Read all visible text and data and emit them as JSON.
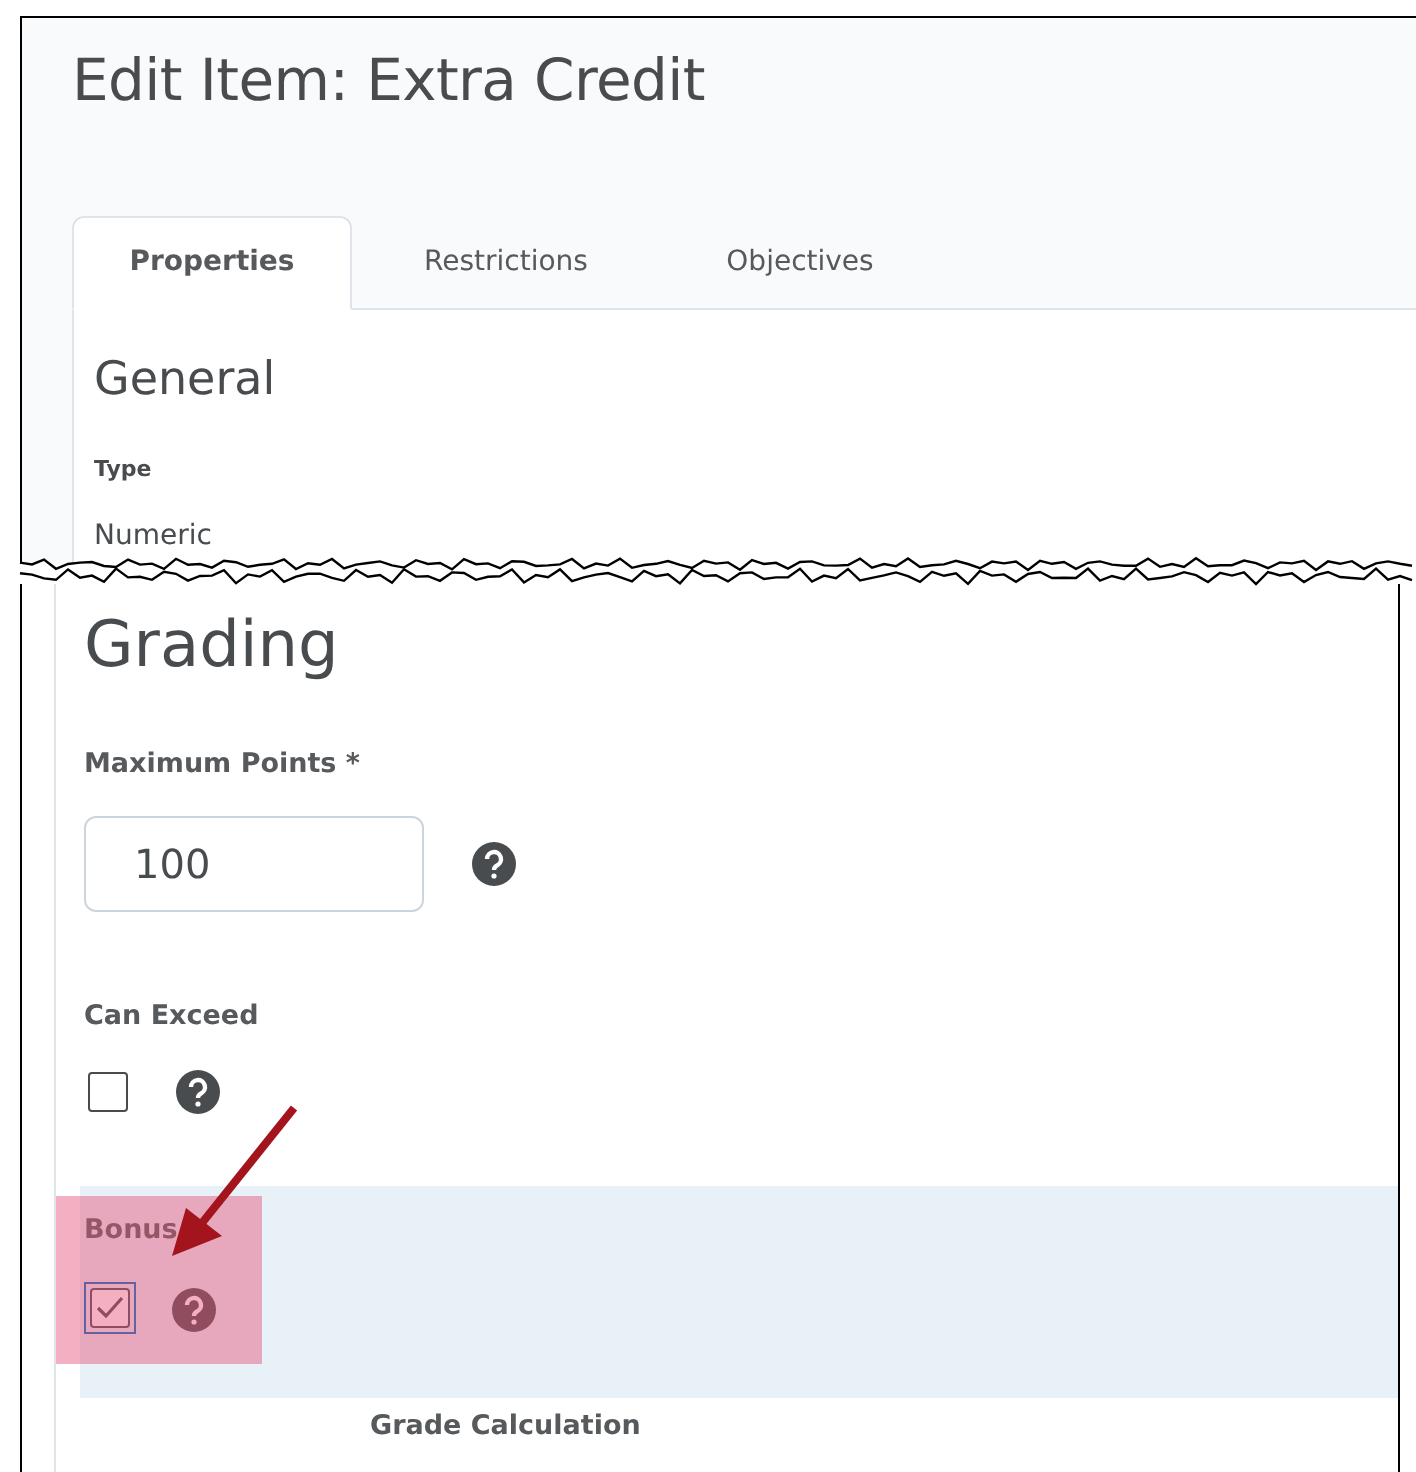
{
  "page": {
    "title": "Edit Item: Extra Credit"
  },
  "tabs": [
    {
      "label": "Properties",
      "selected": true
    },
    {
      "label": "Restrictions",
      "selected": false
    },
    {
      "label": "Objectives",
      "selected": false
    }
  ],
  "general": {
    "heading": "General",
    "type_label": "Type",
    "type_value": "Numeric"
  },
  "grading": {
    "heading": "Grading",
    "max_points": {
      "label": "Maximum Points *",
      "value": "100"
    },
    "can_exceed": {
      "label": "Can Exceed",
      "checked": false
    },
    "bonus": {
      "label": "Bonus",
      "checked": true
    },
    "next_label": "Grade Calculation"
  }
}
